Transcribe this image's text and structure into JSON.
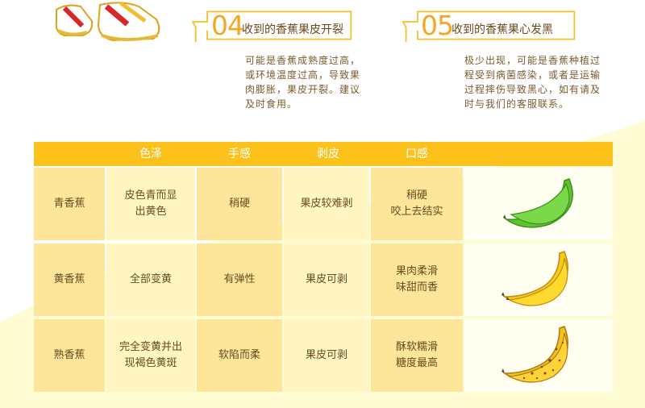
{
  "tips": [
    {
      "number": "04",
      "title": "收到的香蕉果皮开裂",
      "body": [
        "可能是香蕉成熟度过高，",
        "或环境温度过高，导致果",
        "肉膨胀，果皮开裂。建议",
        "及时食用。"
      ]
    },
    {
      "number": "05",
      "title": "收到的香蕉果心发黑",
      "body": [
        "极少出现，可能是香蕉种植过",
        "程受到病菌感染，或者是运输",
        "过程摔伤导致黑心，如有请及",
        "时与我们的客服联系。"
      ]
    }
  ],
  "table": {
    "headers": [
      "",
      "色泽",
      "手感",
      "剥皮",
      "口感"
    ],
    "rows": [
      {
        "name": "青香蕉",
        "color": [
          "皮色青而显",
          "出黄色"
        ],
        "feel": "稍硬",
        "peel": "果皮较难剥",
        "taste": [
          "稍硬",
          "咬上去结实"
        ],
        "banana": "green-banana-icon"
      },
      {
        "name": "黄香蕉",
        "color": [
          "全部变黄"
        ],
        "feel": "有弹性",
        "peel": "果皮可剥",
        "taste": [
          "果肉柔滑",
          "味甜而香"
        ],
        "banana": "yellow-banana-icon"
      },
      {
        "name": "熟香蕉",
        "color": [
          "完全变黄并出",
          "现褐色黄斑"
        ],
        "feel": "软陷而柔",
        "peel": "果皮可剥",
        "taste": [
          "酥软糯滑",
          "糖度最高"
        ],
        "banana": "ripe-banana-icon"
      }
    ]
  },
  "colors": {
    "header": "#fcc11b",
    "accent": "#f5a623",
    "cell_dark": "#fde59a",
    "cell_light": "#fff6c4",
    "page_bg": "#fffbd2"
  }
}
